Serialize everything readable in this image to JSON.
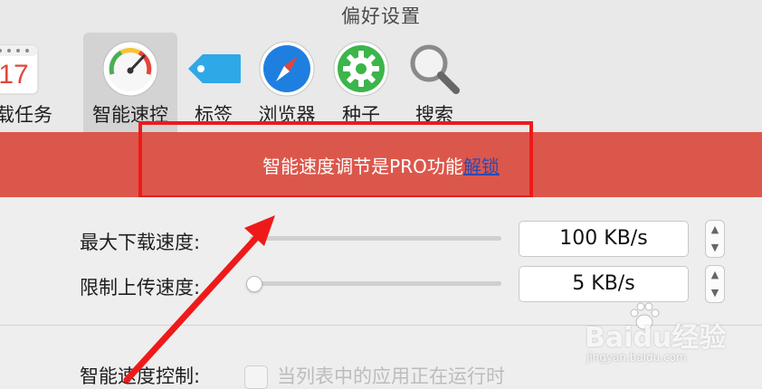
{
  "window": {
    "title": "偏好设置"
  },
  "toolbar": {
    "tabs": [
      {
        "label": "下载任务",
        "icon": "calendar-icon",
        "icon_text": "17"
      },
      {
        "label": "智能速控",
        "icon": "speedometer-icon",
        "selected": true
      },
      {
        "label": "标签",
        "icon": "tag-icon"
      },
      {
        "label": "浏览器",
        "icon": "compass-icon"
      },
      {
        "label": "种子",
        "icon": "gear-icon"
      },
      {
        "label": "搜索",
        "icon": "magnifier-icon"
      }
    ]
  },
  "banner": {
    "text": "智能速度调节是PRO功能",
    "link_label": "解锁",
    "color": "#dc574b"
  },
  "settings": {
    "max_download": {
      "label": "最大下载速度:",
      "value": "100 KB/s"
    },
    "max_upload": {
      "label": "限制上传速度:",
      "value": "5 KB/s"
    },
    "smart_control": {
      "label": "智能速度控制:",
      "checkbox_label": "当列表中的应用正在运行时",
      "checked": false
    }
  },
  "annotation": {
    "color": "#ee1a1a"
  },
  "watermark": {
    "text": "Baidu经验",
    "sub": "jingyan.baidu.com"
  }
}
